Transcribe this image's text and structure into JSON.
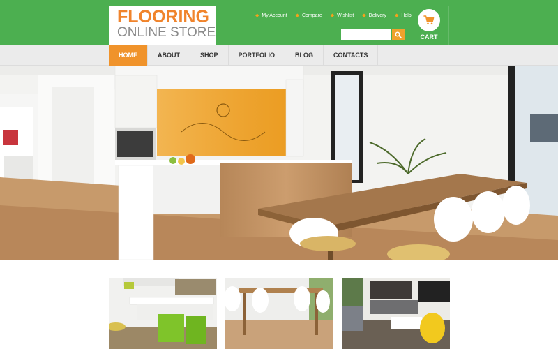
{
  "brand": {
    "line1": "FLOORING",
    "line2": "ONLINE STORE",
    "primary_color": "#4caf50",
    "accent_color": "#f0932b"
  },
  "top_links": [
    {
      "label": "My Account",
      "icon": "bullet"
    },
    {
      "label": "Compare",
      "icon": "bullet"
    },
    {
      "label": "Wishlist",
      "icon": "bullet"
    },
    {
      "label": "Delivery",
      "icon": "bullet"
    },
    {
      "label": "Help",
      "icon": "bullet"
    }
  ],
  "search": {
    "placeholder": "",
    "value": "",
    "button_icon": "search-icon"
  },
  "cart": {
    "label": "CART",
    "icon": "shopping-cart-icon"
  },
  "nav": {
    "items": [
      {
        "label": "HOME",
        "active": true
      },
      {
        "label": "ABOUT",
        "active": false
      },
      {
        "label": "SHOP",
        "active": false
      },
      {
        "label": "PORTFOLIO",
        "active": false
      },
      {
        "label": "BLOG",
        "active": false
      },
      {
        "label": "CONTACTS",
        "active": false
      }
    ]
  },
  "hero": {
    "image": "modern-kitchen-with-wooden-dining-table"
  },
  "thumbnails": [
    {
      "image": "kitchen-with-green-chairs"
    },
    {
      "image": "dining-room-wooden-table"
    },
    {
      "image": "living-room-grey-sofa-yellow-chair"
    }
  ]
}
